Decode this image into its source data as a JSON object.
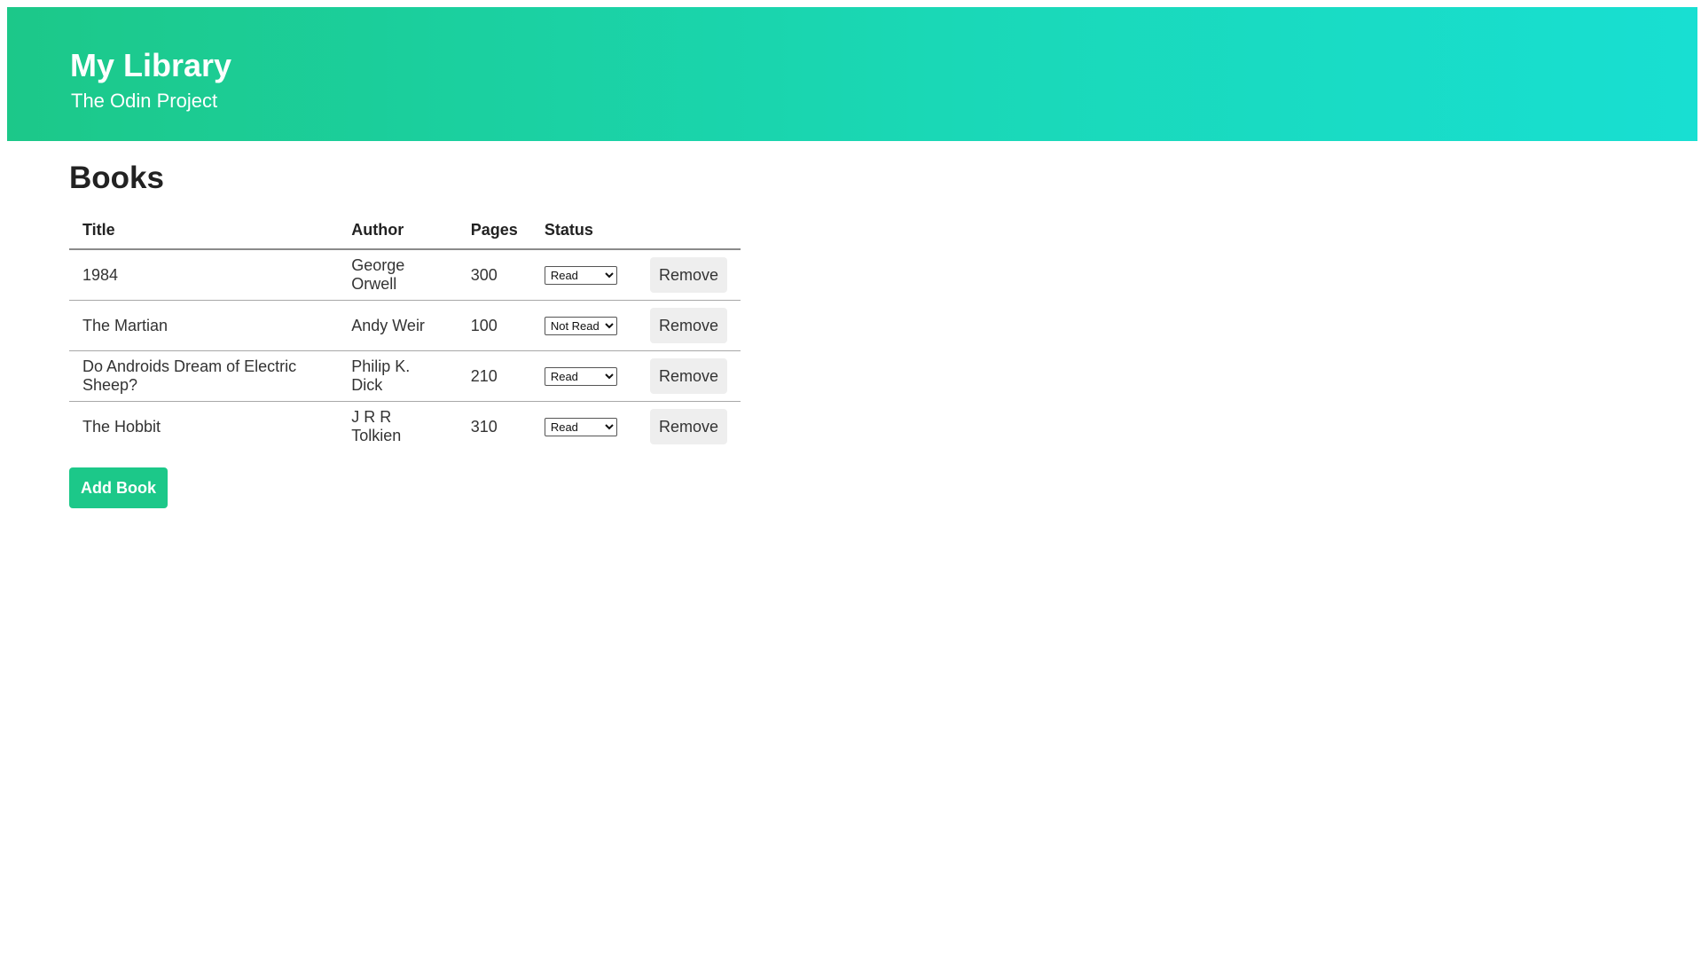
{
  "header": {
    "title": "My Library",
    "subtitle": "The Odin Project",
    "gradient_colors": [
      "#1cc889",
      "#18dfd2"
    ]
  },
  "main": {
    "section_title": "Books",
    "table": {
      "columns": [
        "Title",
        "Author",
        "Pages",
        "Status",
        ""
      ],
      "rows": [
        {
          "title": "1984",
          "author": "George Orwell",
          "pages": "300",
          "status": "Read",
          "action": "Remove"
        },
        {
          "title": "The Martian",
          "author": "Andy Weir",
          "pages": "100",
          "status": "Not Read",
          "action": "Remove"
        },
        {
          "title": "Do Androids Dream of Electric Sheep?",
          "author": "Philip K. Dick",
          "pages": "210",
          "status": "Read",
          "action": "Remove"
        },
        {
          "title": "The Hobbit",
          "author": "J R R Tolkien",
          "pages": "310",
          "status": "Read",
          "action": "Remove"
        }
      ]
    },
    "add_button_label": "Add Book",
    "accent_color": "#1cc889"
  }
}
